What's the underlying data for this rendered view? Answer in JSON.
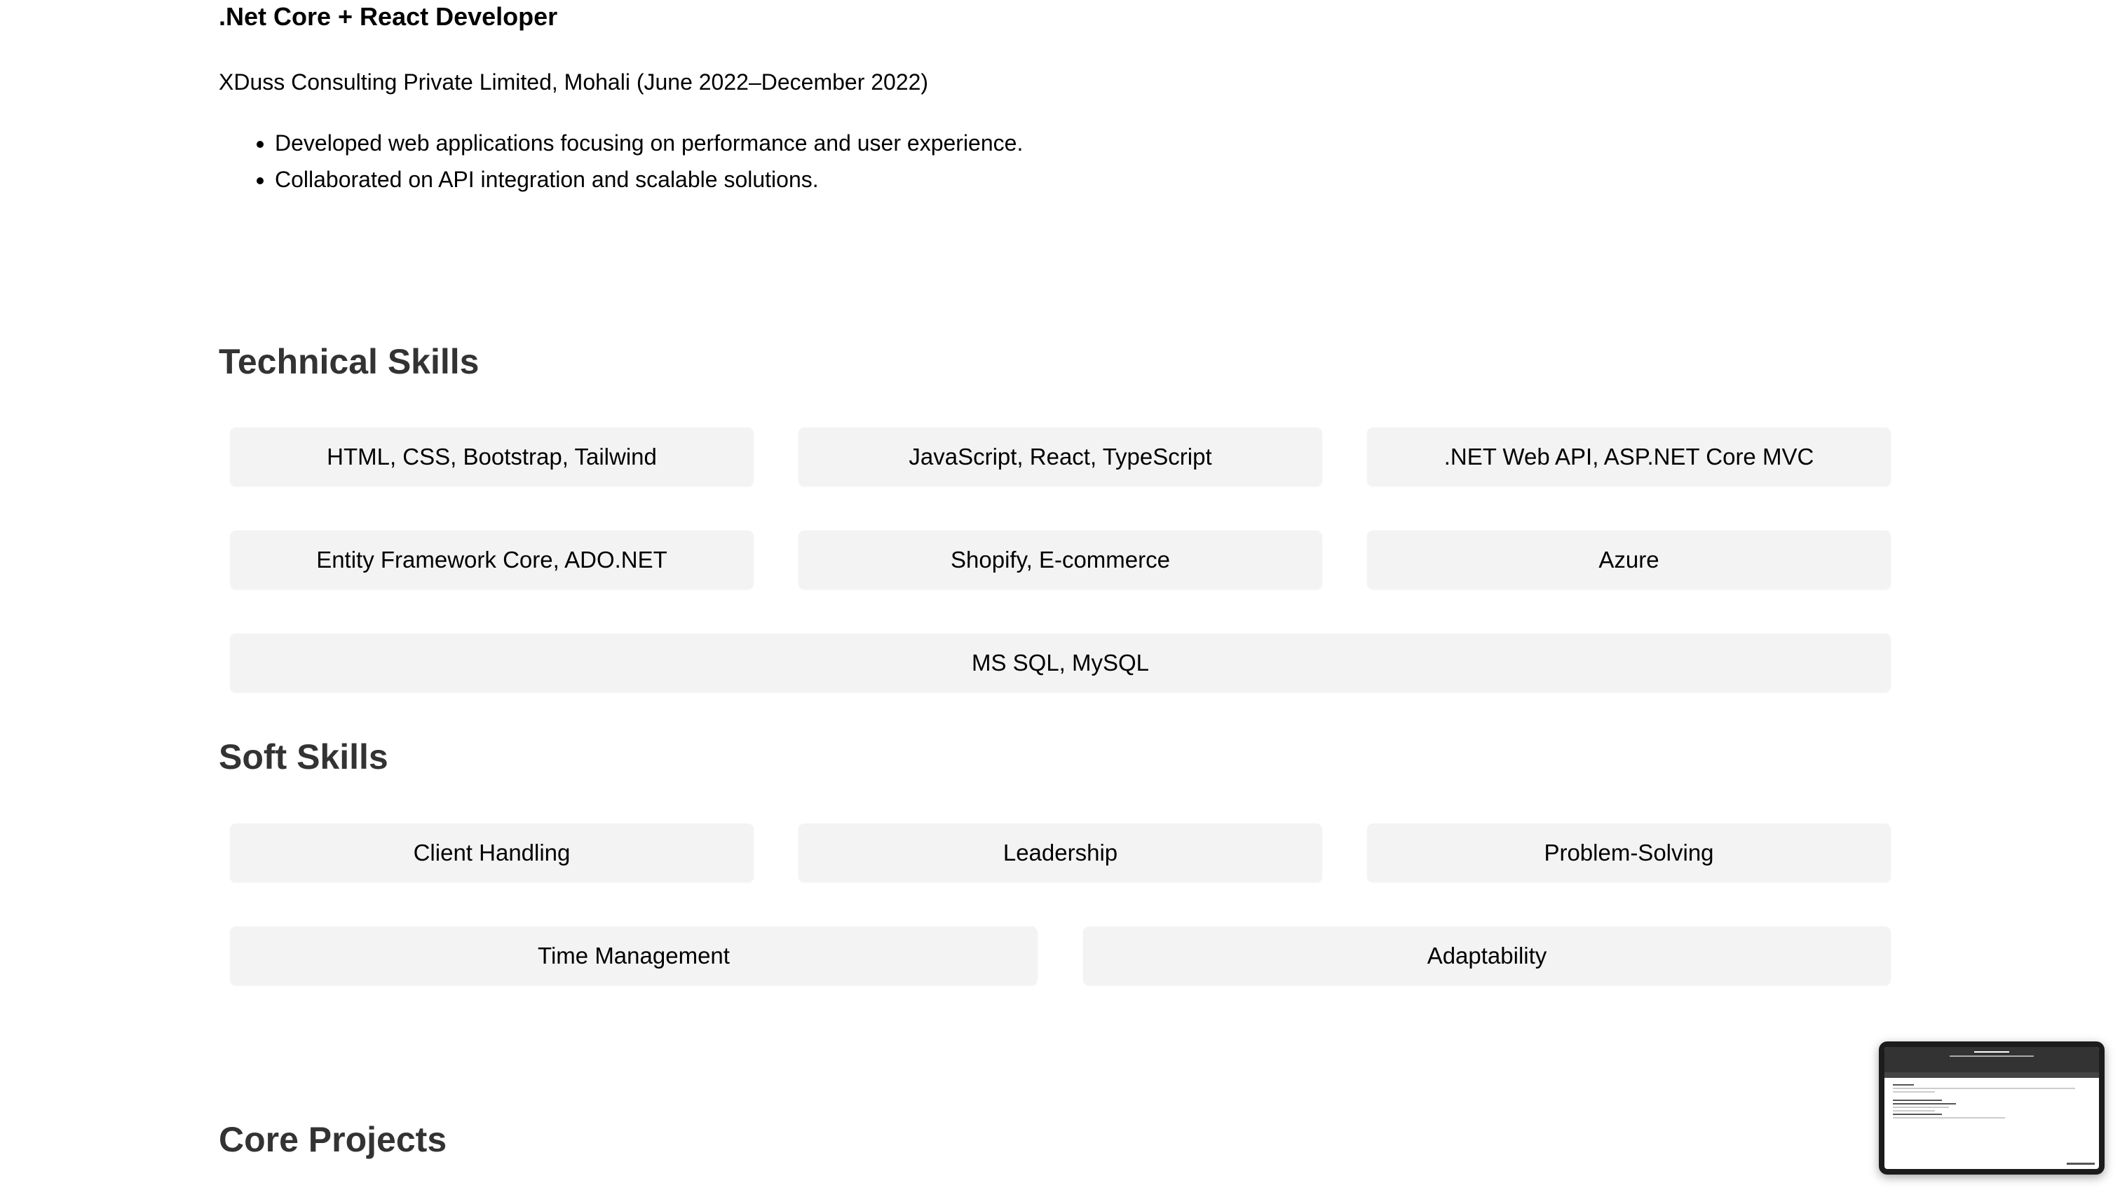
{
  "experience": {
    "job_title": ".Net Core + React Developer",
    "company": "XDuss Consulting Private Limited, Mohali (June 2022–December 2022)",
    "bullets": [
      "Developed web applications focusing on performance and user experience.",
      "Collaborated on API integration and scalable solutions."
    ]
  },
  "technical_skills": {
    "heading": "Technical Skills",
    "items": [
      "HTML, CSS, Bootstrap, Tailwind",
      "JavaScript, React, TypeScript",
      ".NET Web API, ASP.NET Core MVC",
      "Entity Framework Core, ADO.NET",
      "Shopify, E-commerce",
      "Azure",
      "MS SQL, MySQL"
    ]
  },
  "soft_skills": {
    "heading": "Soft Skills",
    "items": [
      "Client Handling",
      "Leadership",
      "Problem-Solving",
      "Time Management",
      "Adaptability"
    ]
  },
  "projects": {
    "heading": "Core Projects"
  },
  "colors": {
    "heading": "#333333",
    "skill_bg": "#f3f3f3",
    "text": "#000000"
  }
}
